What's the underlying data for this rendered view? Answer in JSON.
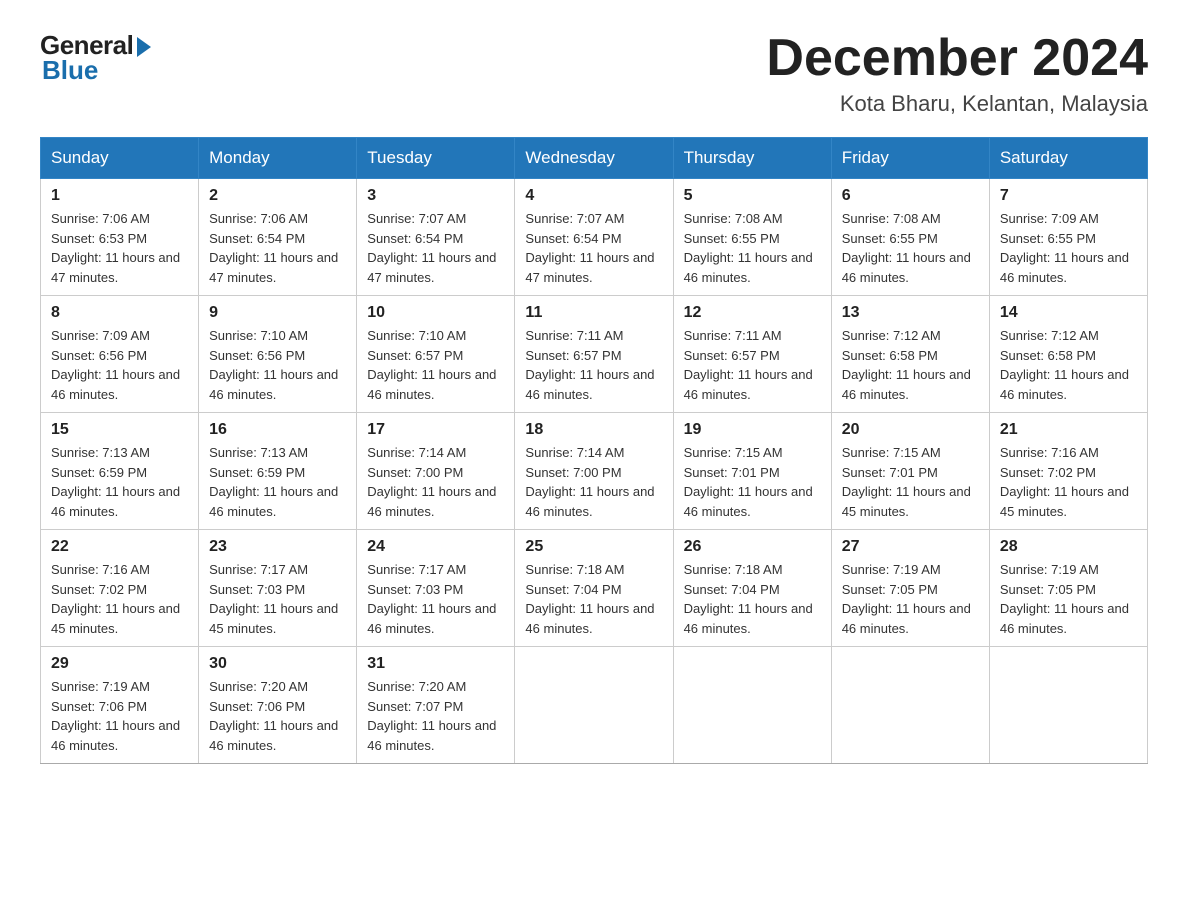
{
  "header": {
    "logo_general": "General",
    "logo_blue": "Blue",
    "month_title": "December 2024",
    "location": "Kota Bharu, Kelantan, Malaysia"
  },
  "days_of_week": [
    "Sunday",
    "Monday",
    "Tuesday",
    "Wednesday",
    "Thursday",
    "Friday",
    "Saturday"
  ],
  "weeks": [
    [
      {
        "day": "1",
        "sunrise": "7:06 AM",
        "sunset": "6:53 PM",
        "daylight": "11 hours and 47 minutes."
      },
      {
        "day": "2",
        "sunrise": "7:06 AM",
        "sunset": "6:54 PM",
        "daylight": "11 hours and 47 minutes."
      },
      {
        "day": "3",
        "sunrise": "7:07 AM",
        "sunset": "6:54 PM",
        "daylight": "11 hours and 47 minutes."
      },
      {
        "day": "4",
        "sunrise": "7:07 AM",
        "sunset": "6:54 PM",
        "daylight": "11 hours and 47 minutes."
      },
      {
        "day": "5",
        "sunrise": "7:08 AM",
        "sunset": "6:55 PM",
        "daylight": "11 hours and 46 minutes."
      },
      {
        "day": "6",
        "sunrise": "7:08 AM",
        "sunset": "6:55 PM",
        "daylight": "11 hours and 46 minutes."
      },
      {
        "day": "7",
        "sunrise": "7:09 AM",
        "sunset": "6:55 PM",
        "daylight": "11 hours and 46 minutes."
      }
    ],
    [
      {
        "day": "8",
        "sunrise": "7:09 AM",
        "sunset": "6:56 PM",
        "daylight": "11 hours and 46 minutes."
      },
      {
        "day": "9",
        "sunrise": "7:10 AM",
        "sunset": "6:56 PM",
        "daylight": "11 hours and 46 minutes."
      },
      {
        "day": "10",
        "sunrise": "7:10 AM",
        "sunset": "6:57 PM",
        "daylight": "11 hours and 46 minutes."
      },
      {
        "day": "11",
        "sunrise": "7:11 AM",
        "sunset": "6:57 PM",
        "daylight": "11 hours and 46 minutes."
      },
      {
        "day": "12",
        "sunrise": "7:11 AM",
        "sunset": "6:57 PM",
        "daylight": "11 hours and 46 minutes."
      },
      {
        "day": "13",
        "sunrise": "7:12 AM",
        "sunset": "6:58 PM",
        "daylight": "11 hours and 46 minutes."
      },
      {
        "day": "14",
        "sunrise": "7:12 AM",
        "sunset": "6:58 PM",
        "daylight": "11 hours and 46 minutes."
      }
    ],
    [
      {
        "day": "15",
        "sunrise": "7:13 AM",
        "sunset": "6:59 PM",
        "daylight": "11 hours and 46 minutes."
      },
      {
        "day": "16",
        "sunrise": "7:13 AM",
        "sunset": "6:59 PM",
        "daylight": "11 hours and 46 minutes."
      },
      {
        "day": "17",
        "sunrise": "7:14 AM",
        "sunset": "7:00 PM",
        "daylight": "11 hours and 46 minutes."
      },
      {
        "day": "18",
        "sunrise": "7:14 AM",
        "sunset": "7:00 PM",
        "daylight": "11 hours and 46 minutes."
      },
      {
        "day": "19",
        "sunrise": "7:15 AM",
        "sunset": "7:01 PM",
        "daylight": "11 hours and 46 minutes."
      },
      {
        "day": "20",
        "sunrise": "7:15 AM",
        "sunset": "7:01 PM",
        "daylight": "11 hours and 45 minutes."
      },
      {
        "day": "21",
        "sunrise": "7:16 AM",
        "sunset": "7:02 PM",
        "daylight": "11 hours and 45 minutes."
      }
    ],
    [
      {
        "day": "22",
        "sunrise": "7:16 AM",
        "sunset": "7:02 PM",
        "daylight": "11 hours and 45 minutes."
      },
      {
        "day": "23",
        "sunrise": "7:17 AM",
        "sunset": "7:03 PM",
        "daylight": "11 hours and 45 minutes."
      },
      {
        "day": "24",
        "sunrise": "7:17 AM",
        "sunset": "7:03 PM",
        "daylight": "11 hours and 46 minutes."
      },
      {
        "day": "25",
        "sunrise": "7:18 AM",
        "sunset": "7:04 PM",
        "daylight": "11 hours and 46 minutes."
      },
      {
        "day": "26",
        "sunrise": "7:18 AM",
        "sunset": "7:04 PM",
        "daylight": "11 hours and 46 minutes."
      },
      {
        "day": "27",
        "sunrise": "7:19 AM",
        "sunset": "7:05 PM",
        "daylight": "11 hours and 46 minutes."
      },
      {
        "day": "28",
        "sunrise": "7:19 AM",
        "sunset": "7:05 PM",
        "daylight": "11 hours and 46 minutes."
      }
    ],
    [
      {
        "day": "29",
        "sunrise": "7:19 AM",
        "sunset": "7:06 PM",
        "daylight": "11 hours and 46 minutes."
      },
      {
        "day": "30",
        "sunrise": "7:20 AM",
        "sunset": "7:06 PM",
        "daylight": "11 hours and 46 minutes."
      },
      {
        "day": "31",
        "sunrise": "7:20 AM",
        "sunset": "7:07 PM",
        "daylight": "11 hours and 46 minutes."
      },
      null,
      null,
      null,
      null
    ]
  ],
  "labels": {
    "sunrise": "Sunrise:",
    "sunset": "Sunset:",
    "daylight": "Daylight:"
  }
}
